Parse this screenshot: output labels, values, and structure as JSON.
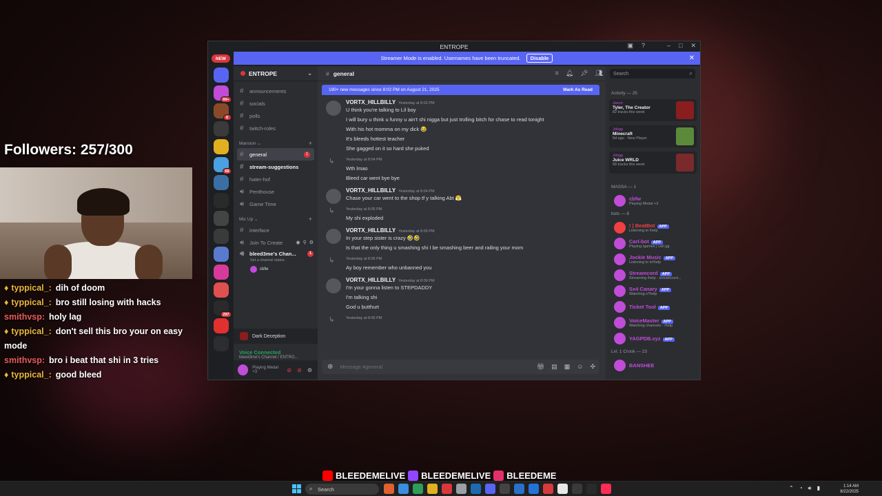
{
  "overlay": {
    "followers": "Followers: 257/300",
    "chat": [
      {
        "user": "typpical_:",
        "text": "dih of doom",
        "color": "gold"
      },
      {
        "user": "typpical_:",
        "text": "bro still losing with hacks",
        "color": "gold"
      },
      {
        "user": "smithvsp:",
        "text": "holy lag",
        "color": "red"
      },
      {
        "user": "typpical_:",
        "text": "don't sell this bro your on easy mode",
        "color": "gold"
      },
      {
        "user": "smithvsp:",
        "text": "bro i beat that shi in 3 tries",
        "color": "red"
      },
      {
        "user": "typpical_:",
        "text": "good bleed",
        "color": "gold"
      }
    ],
    "socials": [
      "BLEEDEMELIVE",
      "BLEEDEMELIVE",
      "BLEEDEME"
    ]
  },
  "window": {
    "title": "ENTROPE",
    "new_badge": "NEW",
    "streamer_text": "Streamer Mode is enabled. Usernames have been truncated.",
    "disable_label": "Disable"
  },
  "guild_badges": [
    "",
    "99+",
    "8",
    "",
    "",
    "68",
    "",
    "",
    "",
    "",
    "",
    "",
    "",
    "297",
    "",
    ""
  ],
  "sidebar": {
    "server_name": "ENTROPE",
    "channels_top": [
      "announcements",
      "socials",
      "polls",
      "twitch-roles"
    ],
    "category_mansion": "Mansion",
    "mansion": [
      {
        "name": "general",
        "state": "active",
        "unread": "1",
        "type": "text"
      },
      {
        "name": "stream-suggestions",
        "state": "bold",
        "unread": "",
        "type": "text"
      },
      {
        "name": "hater-hof",
        "state": "",
        "unread": "",
        "type": "text"
      },
      {
        "name": "Penthouse",
        "state": "",
        "unread": "",
        "type": "voice"
      },
      {
        "name": "Game Time",
        "state": "",
        "unread": "",
        "type": "voice"
      }
    ],
    "category_mic": "Mic Up",
    "mic": [
      {
        "name": "interface",
        "type": "text"
      },
      {
        "name": "Join To Create",
        "type": "voice"
      }
    ],
    "voice_channel": "bleed3me's Chan...",
    "voice_status": "Set a channel status",
    "voice_user": "cbfw",
    "now_playing": "Dark Deception",
    "vc_title": "Voice Connected",
    "vc_sub": "bleed3me's Channel / ENTRO...",
    "user_status": "Playing Medal +3"
  },
  "main": {
    "channel": "general",
    "new_messages": "190+ new messages since 8:02 PM on August 21, 2025",
    "mark_read": "Mark As Read",
    "composer_placeholder": "Message #general",
    "messages": [
      {
        "author": "VORTX_HILLBILLY",
        "ts": "Yesterday at 8:02 PM",
        "reply": "",
        "lines": [
          "U think you're talking to Lil boy",
          "I will bury u think u funny u ain't shi nigga but just  trolling bitch for chase to read tonight",
          "With his hot momma on my dick 😂",
          "It's bleeds hottest teacher",
          "She gagged on it so hard she puked"
        ]
      },
      {
        "author": "",
        "ts": "",
        "reply": "Yesterday at 8:04 PM",
        "lines": [
          "Wth lmao",
          "Bleed car went bye bye"
        ]
      },
      {
        "author": "VORTX_HILLBILLY",
        "ts": "Yesterday at 8:04 PM",
        "reply": "",
        "lines": [
          "Chase your car went to the shop tf y talking Abt 😤"
        ]
      },
      {
        "author": "",
        "ts": "",
        "reply": "Yesterday at 8:05 PM",
        "lines": [
          "My shi exploded"
        ]
      },
      {
        "author": "VORTX_HILLBILLY",
        "ts": "Yesterday at 8:05 PM",
        "reply": "",
        "lines": [
          "In your step sister is crazy 🤣🤣",
          "Is that the only thing u smashing shi I be smashing beer and railing your mom"
        ]
      },
      {
        "author": "",
        "ts": "",
        "reply": "Yesterday at 8:06 PM",
        "lines": [
          "Ay boy remember who unbanned you"
        ]
      },
      {
        "author": "VORTX_HILLBILLY",
        "ts": "Yesterday at 8:06 PM",
        "reply": "",
        "lines": [
          "I'm your gonna listen to STEPDADDY",
          "I'm talking shi",
          "God u butthurt"
        ]
      },
      {
        "author": "",
        "ts": "",
        "reply": "Yesterday at 8:06 PM",
        "lines": []
      }
    ]
  },
  "members": {
    "search_placeholder": "Search",
    "activity_title": "Activity — 25",
    "activity": [
      {
        "user": "Jason",
        "title": "Tyler, The Creator",
        "sub": "82 tracks this week",
        "color": "#8a1d1d"
      },
      {
        "user": "Jdogg",
        "title": "Minecraft",
        "sub": "5d ago · New Player",
        "color": "#5b8a3a"
      },
      {
        "user": "Jdogg",
        "title": "Juice WRLD",
        "sub": "68 tracks this week",
        "color": "#7a2a2a"
      }
    ],
    "massa_title": "MASSA — 1",
    "massa": [
      {
        "name": "cbfw",
        "sub": "Playing Medal +3",
        "color": "#c14cd8"
      }
    ],
    "bots_title": "bots — 8",
    "bots": [
      {
        "name": "! | BeatBot",
        "sub": "Listening to /help",
        "color": "#f23f43"
      },
      {
        "name": "Carl-bot",
        "sub": "Playing /games | carl.gg",
        "color": "#c14cd8"
      },
      {
        "name": "Jockie Music",
        "sub": "Listening to m!help",
        "color": "#c14cd8"
      },
      {
        "name": "Streamcord",
        "sub": "Streaming /help · streamcord...",
        "color": "#c14cd8"
      },
      {
        "name": "Sx4 Canary",
        "sub": "Watching s?help",
        "color": "#c14cd8"
      },
      {
        "name": "Ticket Tool",
        "sub": "",
        "color": "#c14cd8"
      },
      {
        "name": "VoiceMaster",
        "sub": "Watching channels - /help",
        "color": "#c14cd8"
      },
      {
        "name": "YAGPDB.xyz",
        "sub": "",
        "color": "#c14cd8"
      }
    ],
    "app_tag": "APP",
    "crook_title": "Lvl. 1 Crook — 23",
    "crook": [
      {
        "name": "BANSHEE",
        "color": "#c14cd8"
      }
    ]
  },
  "taskbar": {
    "search_placeholder": "Search",
    "time": "1:14 AM",
    "date": "8/22/2025"
  }
}
